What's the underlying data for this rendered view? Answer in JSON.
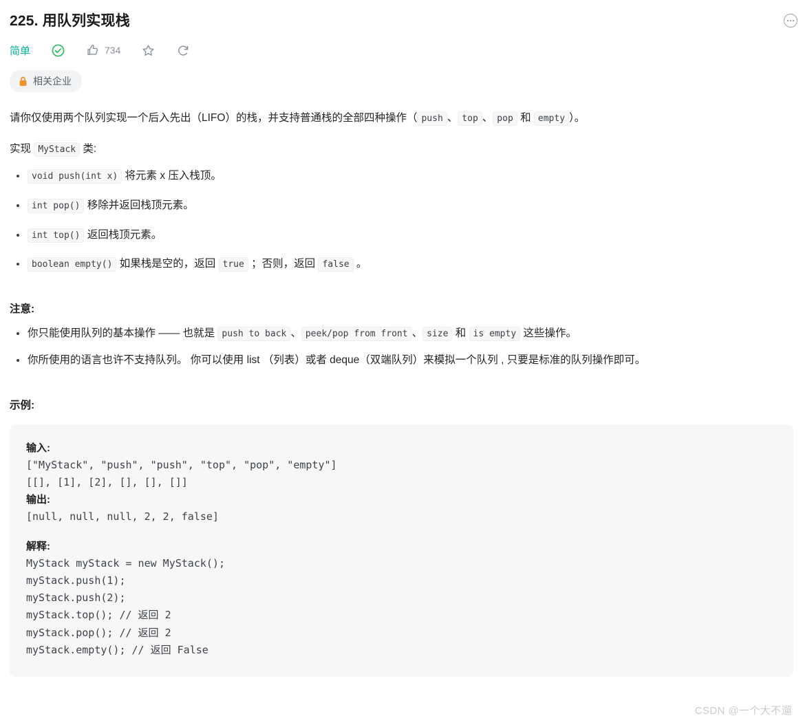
{
  "header": {
    "title": "225. 用队列实现栈",
    "more_icon": "ellipsis-circle-icon"
  },
  "meta": {
    "difficulty": "简单",
    "difficulty_color": "#00af9b",
    "solved_icon": "check-circle-icon",
    "solved_color": "#2cbb5d",
    "like_icon": "thumbs-up-icon",
    "like_count": "734",
    "favorite_icon": "star-outline-icon",
    "share_icon": "share-arrow-icon"
  },
  "company_badge": {
    "lock_icon": "lock-icon",
    "lock_color": "#f0932b",
    "label": "相关企业"
  },
  "description": {
    "intro_p1": "请你仅使用两个队列实现一个后入先出（LIFO）的栈，并支持普通栈的全部四种操作（",
    "intro_chip1": "push",
    "intro_sep1": "、",
    "intro_chip2": "top",
    "intro_sep2": "、",
    "intro_chip3": "pop",
    "intro_sep3": " 和 ",
    "intro_chip4": "empty",
    "intro_p2": "）。",
    "implement_pre": "实现 ",
    "implement_chip": "MyStack",
    "implement_post": " 类:",
    "methods": [
      {
        "signature": "void push(int x)",
        "desc": " 将元素 x 压入栈顶。"
      },
      {
        "signature": "int pop()",
        "desc": " 移除并返回栈顶元素。"
      },
      {
        "signature": "int top()",
        "desc": " 返回栈顶元素。"
      },
      {
        "signature": "boolean empty()",
        "desc_pre": " 如果栈是空的，返回 ",
        "chip_true": "true",
        "desc_mid": " ；否则，返回 ",
        "chip_false": "false",
        "desc_post": " 。"
      }
    ]
  },
  "notes": {
    "title": "注意:",
    "item1_pre": "你只能使用队列的基本操作 —— 也就是 ",
    "item1_chip1": "push to back",
    "item1_sep1": "、",
    "item1_chip2": "peek/pop from front",
    "item1_sep2": "、",
    "item1_chip3": "size",
    "item1_sep3": " 和 ",
    "item1_chip4": "is empty",
    "item1_post": " 这些操作。",
    "item2": "你所使用的语言也许不支持队列。 你可以使用 list （列表）或者 deque（双端队列）来模拟一个队列 , 只要是标准的队列操作即可。"
  },
  "example": {
    "title": "示例:",
    "input_label": "输入:",
    "input_line1": "[\"MyStack\", \"push\", \"push\", \"top\", \"pop\", \"empty\"]",
    "input_line2": "[[], [1], [2], [], [], []]",
    "output_label": "输出:",
    "output_line1": "[null, null, null, 2, 2, false]",
    "explain_label": "解释:",
    "explain_line1": "MyStack myStack = new MyStack();",
    "explain_line2": "myStack.push(1);",
    "explain_line3": "myStack.push(2);",
    "explain_line4": "myStack.top(); // 返回 2",
    "explain_line5": "myStack.pop(); // 返回 2",
    "explain_line6": "myStack.empty(); // 返回 False"
  },
  "watermark": {
    "text": "CSDN @一个大不遛"
  }
}
